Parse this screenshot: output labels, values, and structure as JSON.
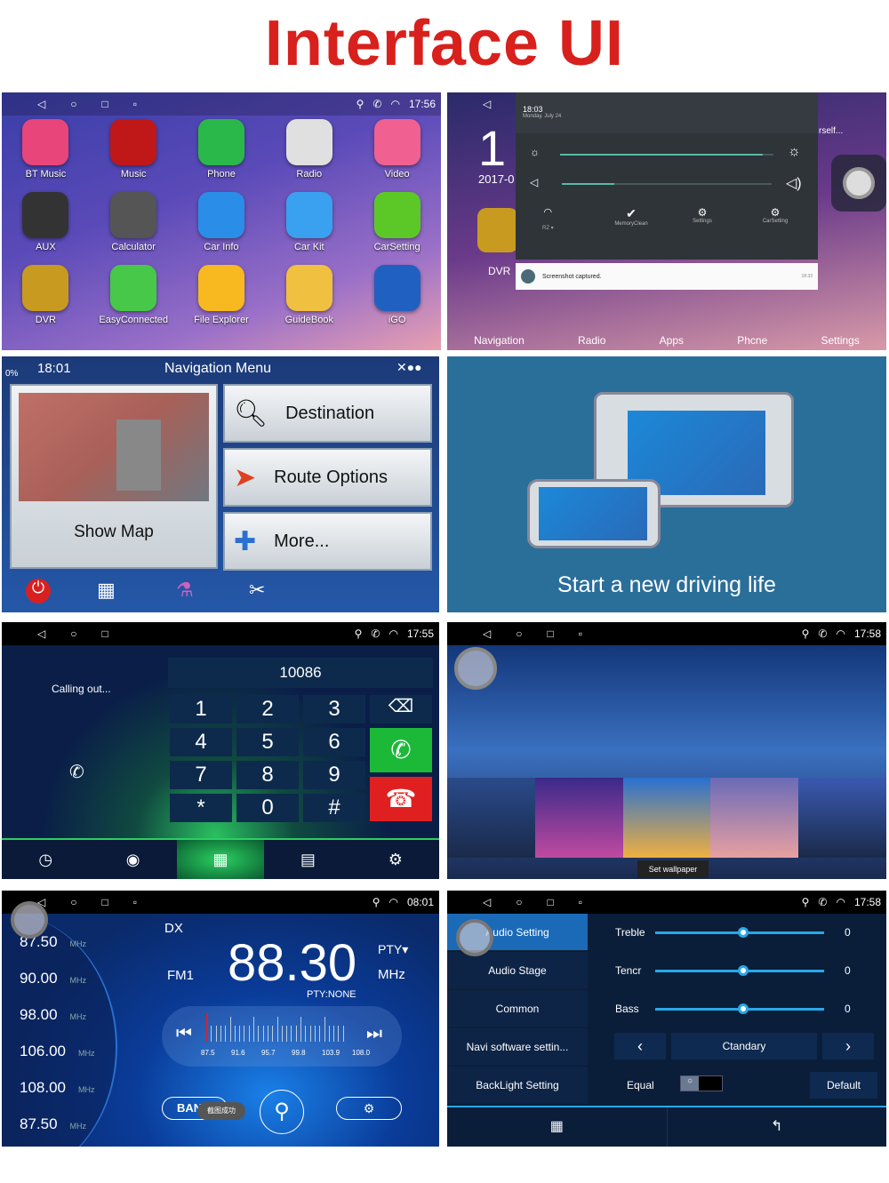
{
  "title": "Interface UI",
  "colors": {
    "title": "#d8201c",
    "accent": "#28a8e8"
  },
  "home": {
    "nav": [
      "◁",
      "○",
      "□",
      "▫"
    ],
    "time": "17:56",
    "apps": [
      {
        "label": "BT Music",
        "icon": "music-note-icon",
        "color": "#e8457a"
      },
      {
        "label": "Music",
        "icon": "vinyl-record-icon",
        "color": "#c01818"
      },
      {
        "label": "Phone",
        "icon": "phone-icon",
        "color": "#2ab84a"
      },
      {
        "label": "Radio",
        "icon": "radio-icon",
        "color": "#e0e0e0"
      },
      {
        "label": "Video",
        "icon": "play-icon",
        "color": "#f06090"
      },
      {
        "label": "AUX",
        "icon": "aux-cable-icon",
        "color": "#333"
      },
      {
        "label": "Calculator",
        "icon": "calculator-icon",
        "color": "#555"
      },
      {
        "label": "Car Info",
        "icon": "car-info-icon",
        "color": "#2a8ee8"
      },
      {
        "label": "Car Kit",
        "icon": "car-icon",
        "color": "#3aa0f0"
      },
      {
        "label": "CarSetting",
        "icon": "toggle-icon",
        "color": "#5cc828"
      },
      {
        "label": "DVR",
        "icon": "camera-icon",
        "color": "#c89a20"
      },
      {
        "label": "EasyConnected",
        "icon": "usb-phone-icon",
        "color": "#48c848"
      },
      {
        "label": "File Explorer",
        "icon": "folder-icon",
        "color": "#f8b820"
      },
      {
        "label": "GuideBook",
        "icon": "book-icon",
        "color": "#f0c040"
      },
      {
        "label": "iGO",
        "icon": "igo-icon",
        "color": "#2060c0"
      }
    ]
  },
  "quick": {
    "time": "18:03",
    "date": "Monday, July 24",
    "clock_partial": "1",
    "date_partial": "2017-0",
    "self_text": "rself...",
    "wifi_label": "RZ ▾",
    "toggles": [
      "MemoryClean",
      "Settings",
      "CarSetting"
    ],
    "brightness": 0.95,
    "volume": 0.25,
    "notification": "Screenshot captured.",
    "notification_time": "18:33",
    "dvr_label": "DVR",
    "dock": [
      "Navigation",
      "Radio",
      "Apps",
      "Phcne",
      "Settings"
    ]
  },
  "navmenu": {
    "time": "18:01",
    "title": "Navigation Menu",
    "battery": "0%",
    "show_map": "Show Map",
    "buttons": [
      "Destination",
      "Route Options",
      "More..."
    ]
  },
  "promo": {
    "text": "Start a new driving life"
  },
  "dialer": {
    "time": "17:55",
    "status": "Calling out...",
    "number": "10086",
    "keys": [
      "1",
      "2",
      "3",
      "4",
      "5",
      "6",
      "7",
      "8",
      "9",
      "*",
      "0",
      "#"
    ]
  },
  "wallpaper": {
    "time": "17:58",
    "button": "Set wallpaper"
  },
  "radio": {
    "time": "08:01",
    "mode": "DX",
    "band": "FM1",
    "frequency": "88.30",
    "unit": "MHz",
    "pty": "PTY",
    "pty_status": "PTY:NONE",
    "presets": [
      "87.50",
      "90.00",
      "98.00",
      "106.00",
      "108.00",
      "87.50"
    ],
    "preset_unit": "MHz",
    "scale": [
      "87.5",
      "91.6",
      "95.7",
      "99.8",
      "103.9",
      "108.0"
    ],
    "band_button": "BAND",
    "toast": "截图成功"
  },
  "audio": {
    "time": "17:58",
    "menu": [
      "Audio Setting",
      "Audio Stage",
      "Common",
      "Navi software settin...",
      "BackLight Setting"
    ],
    "sliders": [
      {
        "label": "Treble",
        "value": "0"
      },
      {
        "label": "Tencr",
        "value": "0"
      },
      {
        "label": "Bass",
        "value": "0"
      }
    ],
    "preset": "Ctandary",
    "equal": "Equal",
    "default": "Default"
  }
}
